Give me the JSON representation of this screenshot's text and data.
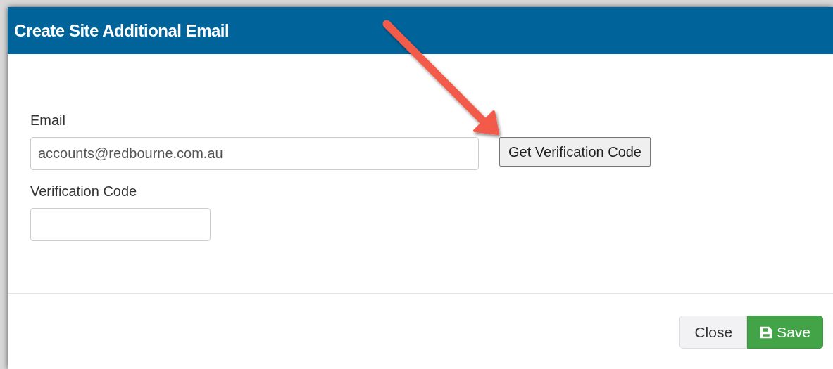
{
  "dialog": {
    "title": "Create Site Additional Email"
  },
  "fields": [
    {
      "label": "Email",
      "value": "accounts@redbourne.com.au",
      "action": "Get Verification Code"
    },
    {
      "label": "Verification Code"
    }
  ],
  "annotation": {
    "kind": "arrow"
  },
  "buttons": [
    {
      "label": "Close",
      "kind": "default"
    },
    {
      "label": "Save",
      "kind": "primary"
    }
  ]
}
